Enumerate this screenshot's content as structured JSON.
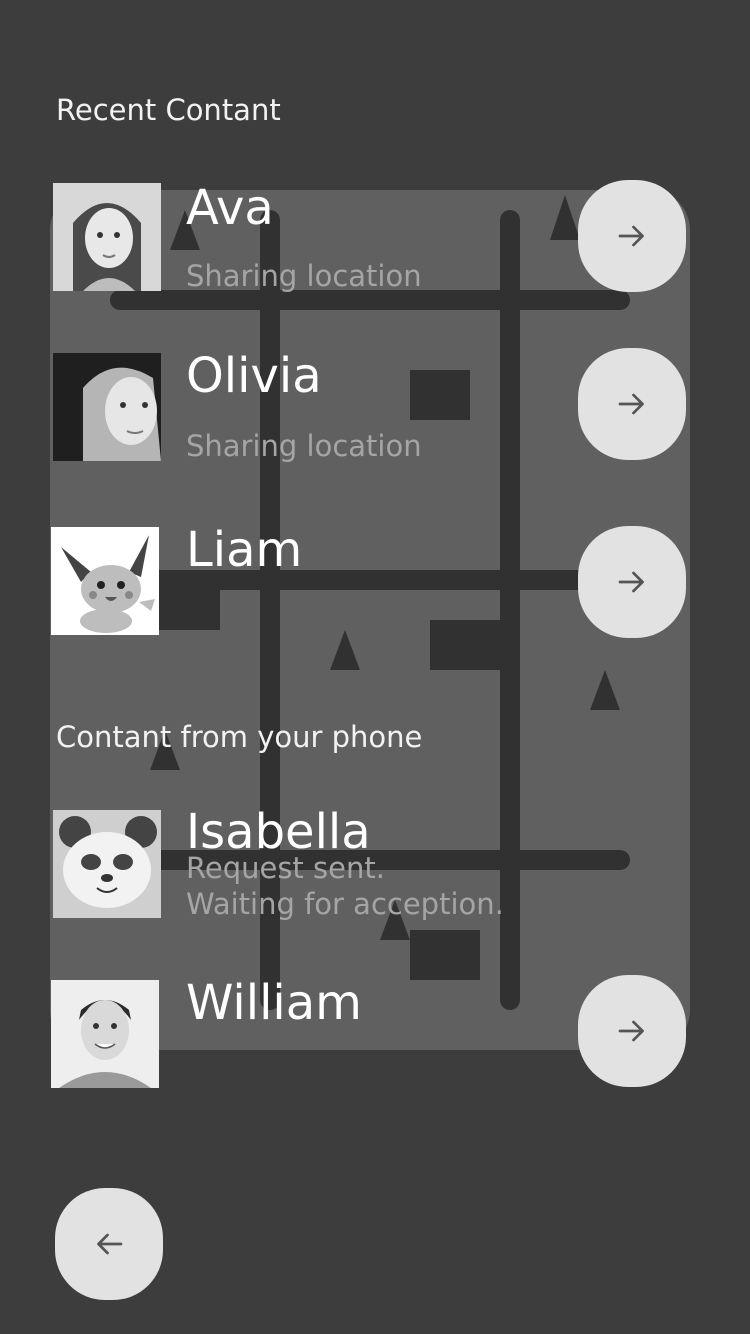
{
  "sections": {
    "recent_title": "Recent Contant",
    "phone_title": "Contant from your phone"
  },
  "contacts": [
    {
      "name": "Ava",
      "status": "Sharing location",
      "avatar_icon": "girl-portrait-icon"
    },
    {
      "name": "Olivia",
      "status": "Sharing location",
      "avatar_icon": "woman-portrait-icon"
    },
    {
      "name": "Liam",
      "status": "",
      "avatar_icon": "pikachu-icon"
    },
    {
      "name": "Isabella",
      "status_line1": "Request sent.",
      "status_line2": "Waiting for acception.",
      "avatar_icon": "panda-icon"
    },
    {
      "name": "William",
      "status": "",
      "avatar_icon": "man-portrait-icon"
    }
  ],
  "icons": {
    "forward": "arrow-right-icon",
    "back": "arrow-left-icon"
  },
  "colors": {
    "background": "#3d3d3d",
    "button": "#e2e2e2",
    "status_text": "#a5a5a5",
    "arrow": "#555555"
  }
}
